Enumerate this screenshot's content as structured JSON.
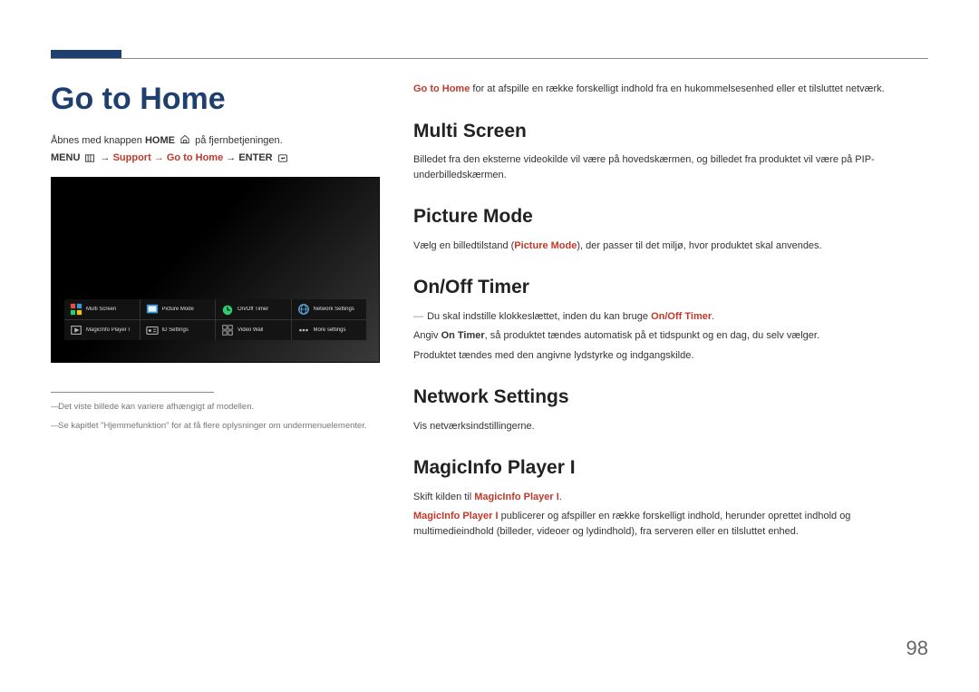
{
  "page_number": "98",
  "title": "Go to Home",
  "left": {
    "open_hint_pre": "Åbnes med knappen ",
    "open_hint_bold": "HOME",
    "open_hint_post": " på fjernbetjeningen.",
    "menu_path": {
      "menu": "MENU",
      "support": "Support",
      "gotohome": "Go to Home",
      "enter": "ENTER"
    },
    "footnotes": [
      "Det viste billede kan variere afhængigt af modellen.",
      "Se kapitlet \"Hjemmefunktion\" for at få flere oplysninger om undermenuelementer."
    ]
  },
  "dock": {
    "row1": [
      {
        "icon": "multiscreen",
        "label": "Multi Screen"
      },
      {
        "icon": "picture",
        "label": "Picture Mode"
      },
      {
        "icon": "timer",
        "label": "On/Off Timer"
      },
      {
        "icon": "network",
        "label": "Network Settings"
      }
    ],
    "row2": [
      {
        "icon": "magic",
        "label": "MagicInfo Player I"
      },
      {
        "icon": "id",
        "label": "ID Settings"
      },
      {
        "icon": "videowall",
        "label": "Video Wall"
      },
      {
        "icon": "more",
        "label": "More settings"
      }
    ]
  },
  "right": {
    "intro": {
      "bold": "Go to Home",
      "rest": " for at afspille en række forskelligt indhold fra en hukommelsesenhed eller et tilsluttet netværk."
    },
    "sections": {
      "multi_screen": {
        "heading": "Multi Screen",
        "body": "Billedet fra den eksterne videokilde vil være på hovedskærmen, og billedet fra produktet vil være på PIP-underbilledskærmen."
      },
      "picture_mode": {
        "heading": "Picture Mode",
        "pre": "Vælg en billedtilstand (",
        "bold": "Picture Mode",
        "post": "), der passer til det miljø, hvor produktet skal anvendes."
      },
      "onoff_timer": {
        "heading": "On/Off Timer",
        "note_pre": "Du skal indstille klokkeslættet, inden du kan bruge ",
        "note_bold": "On/Off Timer",
        "note_post": ".",
        "body1_pre": "Angiv ",
        "body1_bold": "On Timer",
        "body1_post": ", så produktet tændes automatisk på et tidspunkt og en dag, du selv vælger.",
        "body2": "Produktet tændes med den angivne lydstyrke og indgangskilde."
      },
      "network_settings": {
        "heading": "Network Settings",
        "body": "Vis netværksindstillingerne."
      },
      "magicinfo": {
        "heading": "MagicInfo Player I",
        "l1_pre": "Skift kilden til ",
        "l1_bold": "MagicInfo Player I",
        "l1_post": ".",
        "l2_bold": "MagicInfo Player I",
        "l2_rest": " publicerer og afspiller en række forskelligt indhold, herunder oprettet indhold og multimedieindhold (billeder, videoer og lydindhold), fra serveren eller en tilsluttet enhed."
      }
    }
  }
}
